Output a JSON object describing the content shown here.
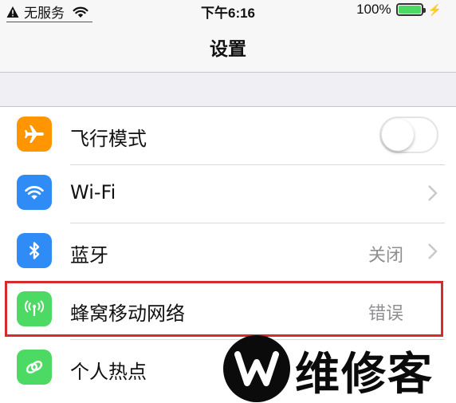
{
  "status_bar": {
    "carrier": "无服务",
    "time": "下午6:16",
    "battery": "100%",
    "battery_level": 1.0
  },
  "nav": {
    "title": "设置"
  },
  "rows": [
    {
      "label": "飞行模式",
      "icon": "airplane-icon",
      "icon_color": "#ff9500",
      "control": "toggle",
      "toggle_on": false
    },
    {
      "label": "Wi-Fi",
      "icon": "wifi-icon",
      "icon_color": "#2f8cf6",
      "control": "chevron",
      "value": ""
    },
    {
      "label": "蓝牙",
      "icon": "bluetooth-icon",
      "icon_color": "#2f8cf6",
      "control": "chevron",
      "value": "关闭"
    },
    {
      "label": "蜂窝移动网络",
      "icon": "cellular-icon",
      "icon_color": "#4cd964",
      "control": "value",
      "value": "错误"
    },
    {
      "label": "个人热点",
      "icon": "hotspot-icon",
      "icon_color": "#4cd964",
      "control": "none",
      "value": ""
    }
  ],
  "highlight_color": "#d52b2b",
  "watermark": {
    "text": "维修客",
    "logo_letter": "W"
  }
}
